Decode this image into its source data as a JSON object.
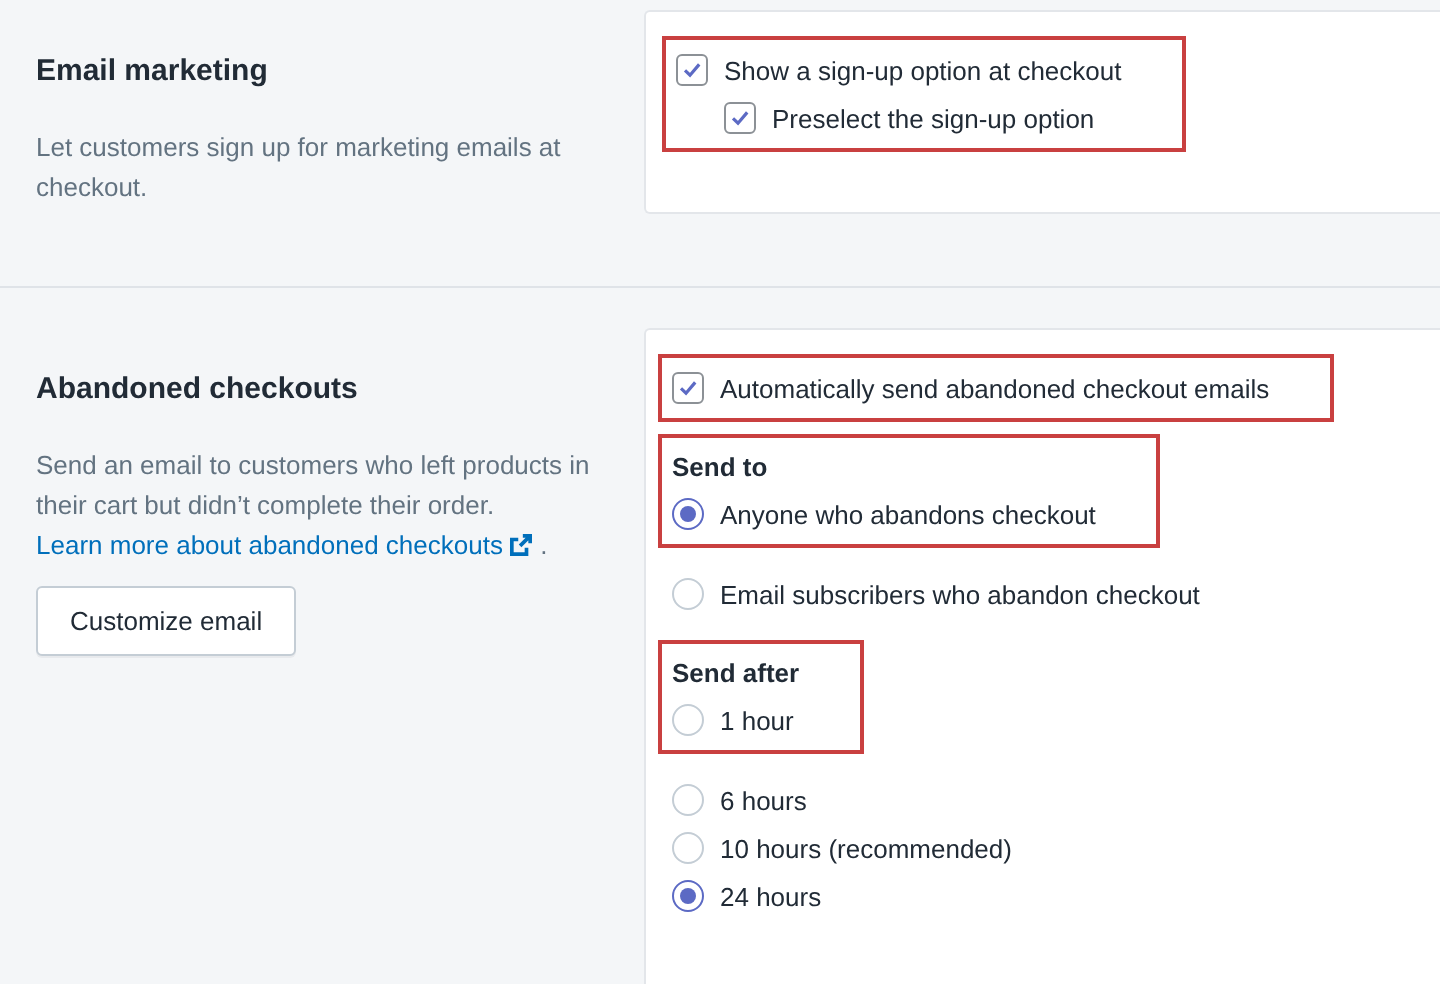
{
  "sections": [
    {
      "title": "Email marketing",
      "description": "Let customers sign up for marketing emails at checkout.",
      "card": {
        "groups": [
          {
            "highlighted": true,
            "items": [
              {
                "kind": "checkbox",
                "label": "Show a sign-up option at checkout",
                "checked": true,
                "children": [
                  {
                    "kind": "checkbox",
                    "label": "Preselect the sign-up option",
                    "checked": true
                  }
                ]
              }
            ]
          }
        ]
      }
    },
    {
      "title": "Abandoned checkouts",
      "description": "Send an email to customers who left products in their cart but didn’t complete their order.",
      "link": {
        "text": "Learn more about abandoned checkouts",
        "trailing": "."
      },
      "button": "Customize email",
      "card": {
        "groups": [
          {
            "highlighted": true,
            "items": [
              {
                "kind": "checkbox",
                "label": "Automatically send abandoned checkout emails",
                "checked": true
              }
            ]
          },
          {
            "highlighted": true,
            "items": [
              {
                "kind": "heading",
                "label": "Send to"
              },
              {
                "kind": "radio",
                "label": "Anyone who abandons checkout",
                "selected": true
              }
            ]
          },
          {
            "highlighted": false,
            "items": [
              {
                "kind": "radio",
                "label": "Email subscribers who abandon checkout",
                "selected": false
              }
            ]
          },
          {
            "highlighted": true,
            "items": [
              {
                "kind": "heading",
                "label": "Send after"
              },
              {
                "kind": "radio",
                "label": "1 hour",
                "selected": false
              }
            ]
          },
          {
            "highlighted": false,
            "items": [
              {
                "kind": "radio",
                "label": "6 hours",
                "selected": false
              },
              {
                "kind": "radio",
                "label": "10 hours (recommended)",
                "selected": false
              },
              {
                "kind": "radio",
                "label": "24 hours",
                "selected": true
              }
            ]
          }
        ]
      }
    }
  ]
}
